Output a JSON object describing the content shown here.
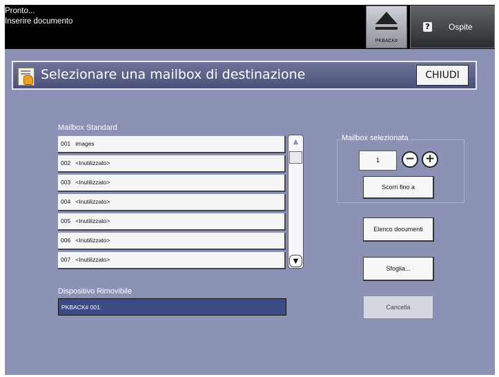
{
  "status": {
    "line1": "Pronto...",
    "line2": "Inserire documento"
  },
  "header": {
    "pkback_label": "PKBACK#",
    "user_label": "Ospite"
  },
  "title": {
    "text": "Selezionare una mailbox di destinazione",
    "close_label": "CHIUDI"
  },
  "mailbox_standard": {
    "label": "Mailbox Standard",
    "items": [
      {
        "text": "001   images"
      },
      {
        "text": "002   <Inutilizzato>"
      },
      {
        "text": "003   <Inutilizzato>"
      },
      {
        "text": "004   <Inutilizzato>"
      },
      {
        "text": "005   <Inutilizzato>"
      },
      {
        "text": "006   <Inutilizzato>"
      },
      {
        "text": "007   <Inutilizzato>"
      }
    ]
  },
  "removable": {
    "label": "Dispositivo Rimovibile",
    "value": "PKBACK# 001:"
  },
  "selected": {
    "label": "Mailbox selezionata",
    "value": "1",
    "minus": "−",
    "plus": "+",
    "scroll_to_label": "Scorri fino a"
  },
  "actions": {
    "doc_list_label": "Elenco documenti",
    "browse_label": "Sfoglia...",
    "delete_label": "Cancella"
  },
  "icons": {
    "eject": "eject-icon",
    "user": "user-icon",
    "title": "mailbox-hand-icon",
    "scroll_up": "chevron-up-icon",
    "scroll_down": "chevron-down-icon"
  },
  "colors": {
    "background": "#8c92b6",
    "title_bar": "#5a6088",
    "removable_field": "#3b4b86"
  }
}
